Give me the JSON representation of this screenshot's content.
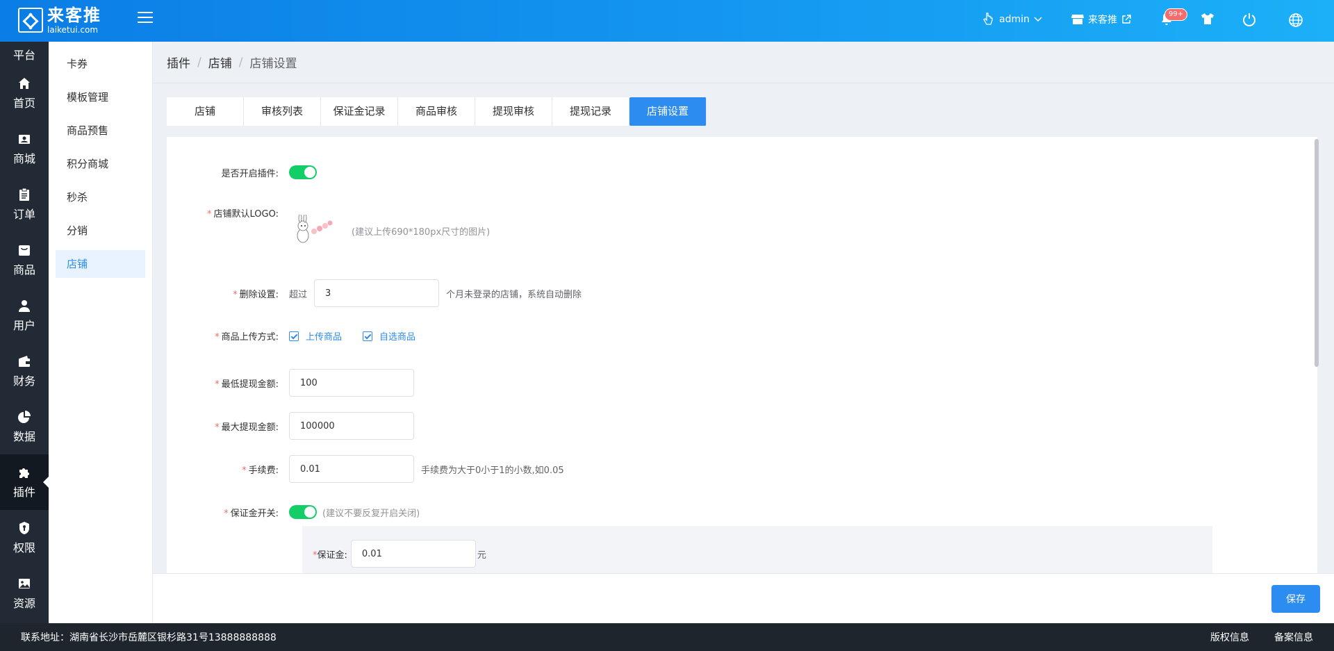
{
  "header": {
    "logo_cn": "来客推",
    "logo_en": "laiketui.com",
    "user": "admin",
    "store": "来客推",
    "notification_badge": "99+"
  },
  "nav": {
    "partial_label": "平台",
    "items": [
      {
        "label": "首页",
        "icon": "home-icon"
      },
      {
        "label": "商城",
        "icon": "shop-icon"
      },
      {
        "label": "订单",
        "icon": "order-icon"
      },
      {
        "label": "商品",
        "icon": "goods-icon"
      },
      {
        "label": "用户",
        "icon": "user-icon"
      },
      {
        "label": "财务",
        "icon": "wallet-icon"
      },
      {
        "label": "数据",
        "icon": "pie-chart-icon"
      },
      {
        "label": "插件",
        "icon": "puzzle-icon"
      },
      {
        "label": "权限",
        "icon": "shield-icon"
      },
      {
        "label": "资源",
        "icon": "image-icon"
      }
    ]
  },
  "submenu": [
    "卡券",
    "模板管理",
    "商品预售",
    "积分商城",
    "秒杀",
    "分销",
    "店铺"
  ],
  "breadcrumb": [
    "插件",
    "店铺",
    "店铺设置"
  ],
  "tabs": [
    "店铺",
    "审核列表",
    "保证金记录",
    "商品审核",
    "提现审核",
    "提现记录",
    "店铺设置"
  ],
  "form": {
    "plugin_label": "是否开启插件:",
    "logo_label": "店铺默认LOGO:",
    "logo_hint": "(建议上传690*180px尺寸的图片)",
    "delete_label": "删除设置:",
    "delete_prefix": "超过",
    "delete_value": "3",
    "delete_suffix": "个月未登录的店铺，系统自动删除",
    "upload_label": "商品上传方式:",
    "upload_opt1": "上传商品",
    "upload_opt2": "自选商品",
    "min_label": "最低提现金额:",
    "min_value": "100",
    "max_label": "最大提现金额:",
    "max_value": "100000",
    "fee_label": "手续费:",
    "fee_value": "0.01",
    "fee_hint": "手续费为大于0小于1的小数,如0.05",
    "deposit_switch_label": "保证金开关:",
    "deposit_switch_hint": "(建议不要反复开启关闭)",
    "deposit_label": "保证金:",
    "deposit_value": "0.01",
    "deposit_unit": "元"
  },
  "save_label": "保存",
  "footer": {
    "address": "联系地址：湖南省长沙市岳麓区银杉路31号13888888888",
    "copyright": "版权信息",
    "filing": "备案信息"
  }
}
